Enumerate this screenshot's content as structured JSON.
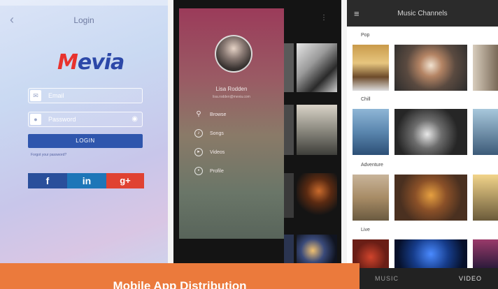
{
  "login_screen": {
    "title": "Login",
    "back_icon": "chevron-left-icon",
    "brand": "Mevia",
    "email_placeholder": "Email",
    "password_placeholder": "Password",
    "login_button": "LOGIN",
    "forgot_link": "Forgot your password?",
    "social_buttons": [
      "f",
      "in",
      "g+"
    ]
  },
  "drawer_screen": {
    "user_name": "Lisa Rodden",
    "user_email": "lisa.rodden@mevia.com",
    "menu_items": [
      {
        "icon": "search-icon",
        "label": "Browse"
      },
      {
        "icon": "music-icon",
        "label": "Songs"
      },
      {
        "icon": "video-icon",
        "label": "Videos"
      },
      {
        "icon": "user-icon",
        "label": "Profile"
      }
    ]
  },
  "channels_screen": {
    "title": "Music Channels",
    "sections": [
      "Pop",
      "Chill",
      "Adventure",
      "Live"
    ],
    "tabs": [
      "MUSIC",
      "VIDEO"
    ]
  },
  "caption": {
    "text": "Mobile App Distribution"
  },
  "colors": {
    "accent_orange": "#eb7a3c",
    "login_blue": "#2f56ad",
    "facebook": "#2a4f9b",
    "linkedin": "#1e76b8",
    "googleplus": "#e04232"
  }
}
